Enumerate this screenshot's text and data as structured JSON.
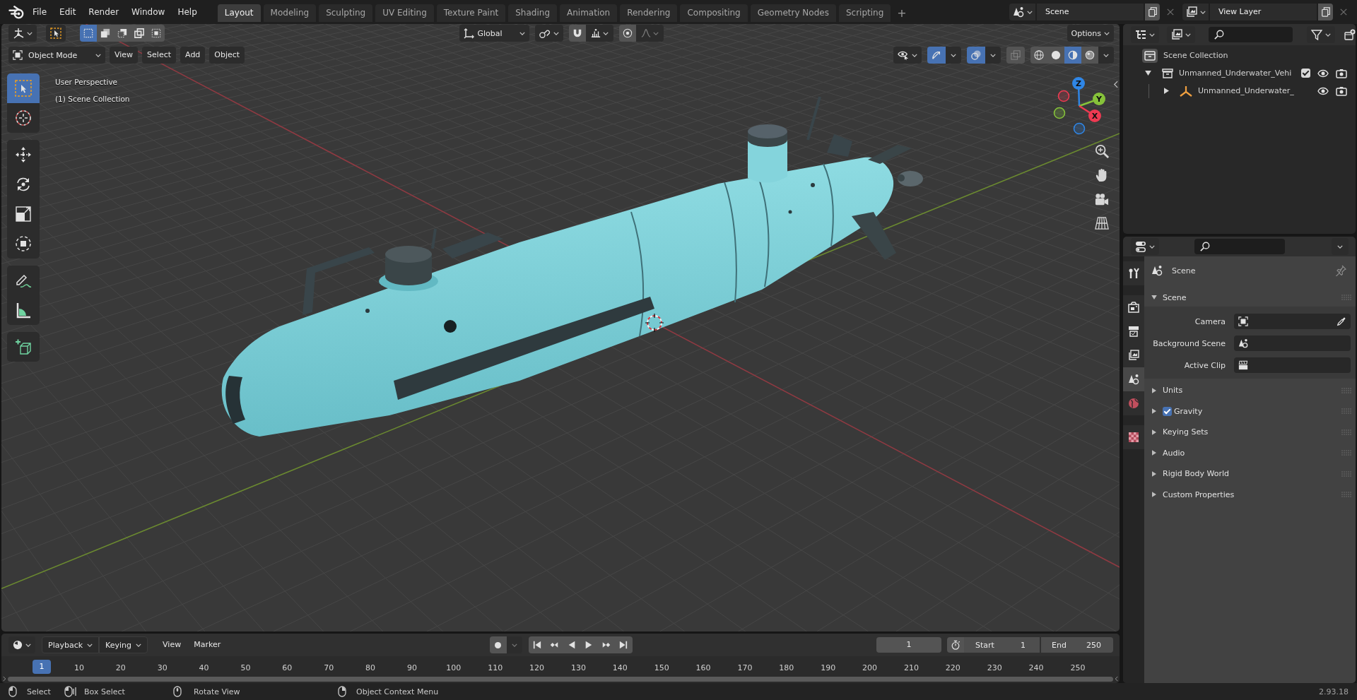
{
  "top_bar": {
    "menus": [
      "File",
      "Edit",
      "Render",
      "Window",
      "Help"
    ],
    "workspaces": [
      {
        "label": "Layout",
        "selected": true
      },
      {
        "label": "Modeling",
        "selected": false
      },
      {
        "label": "Sculpting",
        "selected": false
      },
      {
        "label": "UV Editing",
        "selected": false
      },
      {
        "label": "Texture Paint",
        "selected": false
      },
      {
        "label": "Shading",
        "selected": false
      },
      {
        "label": "Animation",
        "selected": false
      },
      {
        "label": "Rendering",
        "selected": false
      },
      {
        "label": "Compositing",
        "selected": false
      },
      {
        "label": "Geometry Nodes",
        "selected": false
      },
      {
        "label": "Scripting",
        "selected": false
      }
    ],
    "add_workspace": "+",
    "scene": "Scene",
    "view_layer": "View Layer"
  },
  "viewport": {
    "select_modes": [
      {
        "kind": "set",
        "selected": true
      },
      {
        "kind": "extend",
        "selected": false
      },
      {
        "kind": "subtract",
        "selected": false
      },
      {
        "kind": "invert",
        "selected": false
      },
      {
        "kind": "intersect",
        "selected": false
      }
    ],
    "orientation": "Global",
    "options": "Options",
    "mode": "Object Mode",
    "menus": [
      "View",
      "Select",
      "Add",
      "Object"
    ],
    "toggles": [
      {
        "kind": "gizmos",
        "on": true
      },
      {
        "kind": "overlays",
        "on": true
      },
      {
        "kind": "xray",
        "on": false
      }
    ],
    "shading": [
      {
        "kind": "wireframe",
        "selected": false
      },
      {
        "kind": "solid",
        "selected": false
      },
      {
        "kind": "material",
        "selected": true
      },
      {
        "kind": "rendered",
        "selected": false
      }
    ],
    "info": [
      "User Perspective",
      "(1) Scene Collection"
    ],
    "tools": [
      [
        {
          "kind": "select_box",
          "selected": true
        },
        {
          "kind": "cursor",
          "selected": false
        }
      ],
      [
        {
          "kind": "move",
          "selected": false
        },
        {
          "kind": "rotate",
          "selected": false
        },
        {
          "kind": "scale",
          "selected": false
        },
        {
          "kind": "transform",
          "selected": false
        }
      ],
      [
        {
          "kind": "annotate",
          "selected": false
        },
        {
          "kind": "measure",
          "selected": false
        }
      ],
      [
        {
          "kind": "add_cube",
          "selected": false
        }
      ]
    ],
    "gizmo_axes": [
      {
        "label": "Z",
        "color": "#2f86e6"
      },
      {
        "label": "Y",
        "color": "#86c23a"
      },
      {
        "label": "X",
        "color": "#ee3a52"
      }
    ]
  },
  "outliner": {
    "items": [
      {
        "label": "Scene Collection",
        "kind": "scene_collection",
        "children": [
          {
            "label": "Unmanned_Underwater_Vehi",
            "kind": "collection",
            "expanded": true,
            "checked": true,
            "children": [
              {
                "label": "Unmanned_Underwater_",
                "kind": "empty",
                "expanded": false
              }
            ]
          }
        ]
      }
    ]
  },
  "properties": {
    "tabs": [
      [
        {
          "kind": "tool",
          "selected": false
        }
      ],
      [
        {
          "kind": "render",
          "selected": false
        },
        {
          "kind": "output",
          "selected": false
        },
        {
          "kind": "view_layer",
          "selected": false
        },
        {
          "kind": "scene",
          "selected": true
        },
        {
          "kind": "world",
          "selected": false
        }
      ],
      [
        {
          "kind": "texture",
          "selected": false
        }
      ]
    ],
    "context": "Scene",
    "panels": [
      {
        "title": "Scene",
        "kind": "section",
        "expanded": true,
        "fields": [
          {
            "label": "Camera",
            "kind": "camera"
          },
          {
            "label": "Background Scene",
            "kind": "scene"
          },
          {
            "label": "Active Clip",
            "kind": "clip"
          }
        ]
      },
      {
        "title": "Units",
        "kind": "section",
        "expanded": false
      },
      {
        "title": "Gravity",
        "kind": "toggle_section",
        "expanded": false,
        "checked": true
      },
      {
        "title": "Keying Sets",
        "kind": "section",
        "expanded": false
      },
      {
        "title": "Audio",
        "kind": "section",
        "expanded": false
      },
      {
        "title": "Rigid Body World",
        "kind": "section",
        "expanded": false
      },
      {
        "title": "Custom Properties",
        "kind": "section",
        "expanded": false
      }
    ]
  },
  "timeline": {
    "menus": [
      {
        "label": "Playback",
        "kind": "dropdown"
      },
      {
        "label": "Keying",
        "kind": "dropdown"
      },
      {
        "label": "View",
        "kind": "menu"
      },
      {
        "label": "Marker",
        "kind": "menu"
      }
    ],
    "current_frame": "1",
    "start": {
      "label": "Start",
      "value": "1"
    },
    "end": {
      "label": "End",
      "value": "250"
    },
    "playhead": "1",
    "ruler": [
      "10",
      "20",
      "30",
      "40",
      "50",
      "60",
      "70",
      "80",
      "90",
      "100",
      "110",
      "120",
      "130",
      "140",
      "150",
      "160",
      "170",
      "180",
      "190",
      "200",
      "210",
      "220",
      "230",
      "240",
      "250"
    ]
  },
  "status_bar": {
    "hints": [
      {
        "kind": "left_click",
        "label": "Select"
      },
      {
        "kind": "left_drag",
        "label": "Box Select"
      },
      {
        "kind": "middle_drag",
        "label": "Rotate View"
      },
      {
        "kind": "right_click",
        "label": "Object Context Menu"
      }
    ],
    "version": "2.93.18"
  }
}
